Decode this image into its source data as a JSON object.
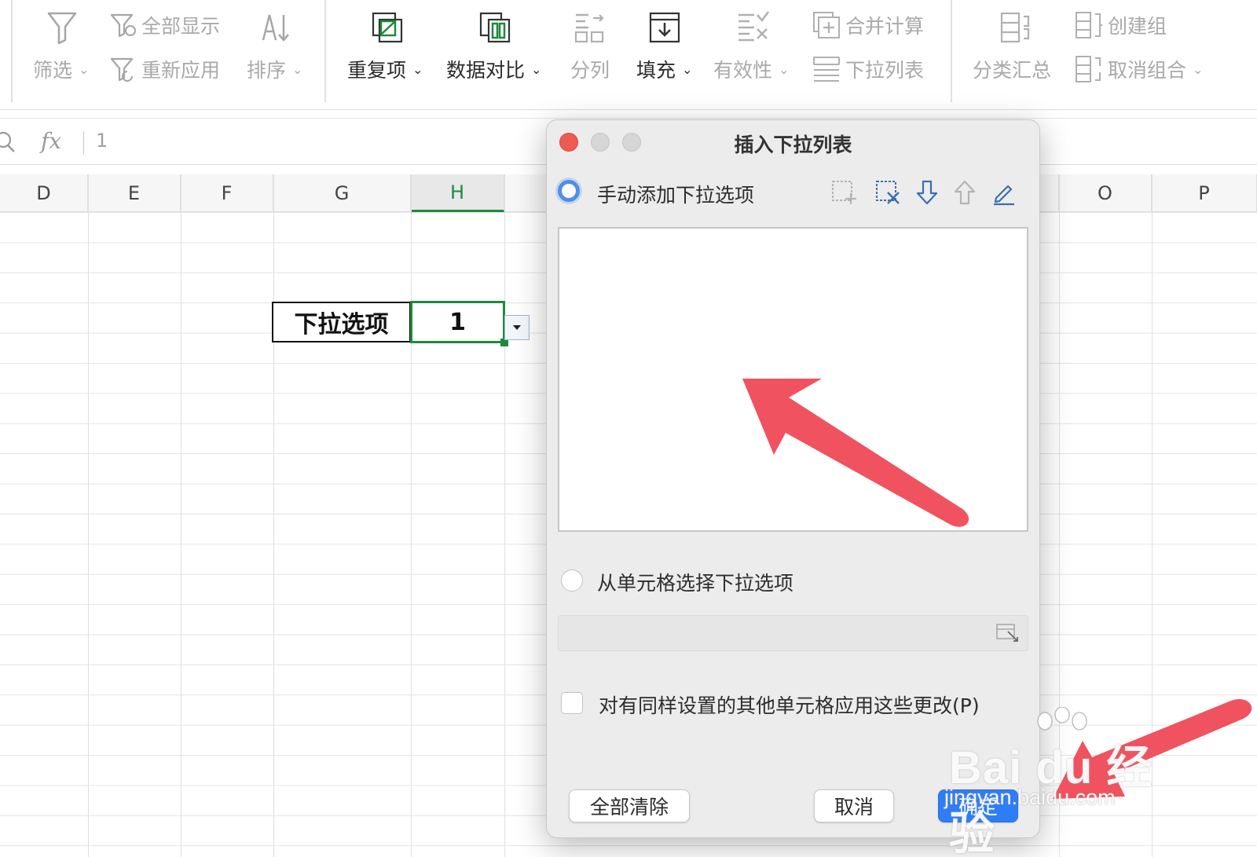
{
  "toolbar": {
    "filter": "筛选",
    "show_all": "全部显示",
    "reapply": "重新应用",
    "sort": "排序",
    "duplicates": "重复项",
    "data_compare": "数据对比",
    "split_column": "分列",
    "fill": "填充",
    "validity": "有效性",
    "merge_calc": "合并计算",
    "dropdown_list": "下拉列表",
    "subtotal": "分类汇总",
    "create_group": "创建组",
    "ungroup": "取消组合"
  },
  "formula_bar": {
    "fx": "fx",
    "value": "1"
  },
  "grid": {
    "columns": [
      "D",
      "E",
      "F",
      "G",
      "H",
      "O",
      "P"
    ],
    "active_column": "H",
    "cells": {
      "g_label": "下拉选项",
      "h_value": "1"
    }
  },
  "dialog": {
    "title": "插入下拉列表",
    "manual_option": "手动添加下拉选项",
    "from_cells_option": "从单元格选择下拉选项",
    "apply_same": "对有同样设置的其他单元格应用这些更改(P)",
    "clear_all": "全部清除",
    "cancel": "取消",
    "ok": "确定"
  },
  "watermark": {
    "brand": "Bai du 经验",
    "url": "jingyan.baidu.com"
  },
  "colors": {
    "accent_green": "#1f8a3b",
    "primary_blue": "#2f7df6",
    "arrow_red": "#f0525f",
    "close_red": "#ee5b52"
  }
}
